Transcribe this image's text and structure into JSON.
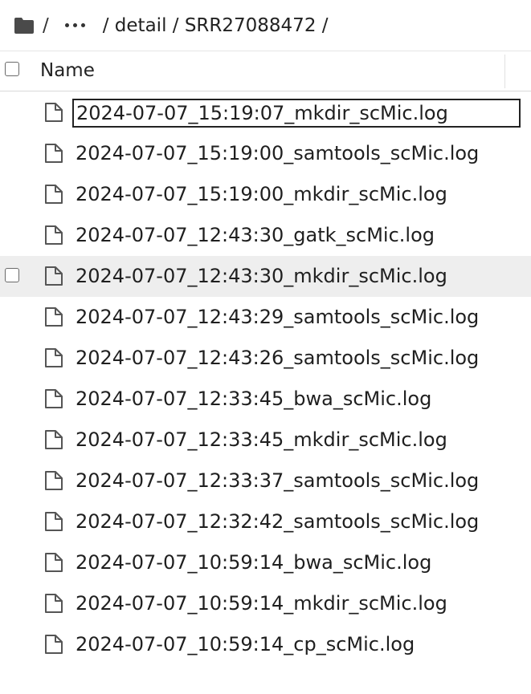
{
  "breadcrumb": {
    "root_sep": "/",
    "ellipsis_label": "…",
    "path_text": "/ detail / SRR27088472 /"
  },
  "table": {
    "header": {
      "name_label": "Name"
    },
    "rows": [
      {
        "name": "2024-07-07_15:19:07_mkdir_scMic.log",
        "state": "editing"
      },
      {
        "name": "2024-07-07_15:19:00_samtools_scMic.log",
        "state": "normal"
      },
      {
        "name": "2024-07-07_15:19:00_mkdir_scMic.log",
        "state": "normal"
      },
      {
        "name": "2024-07-07_12:43:30_gatk_scMic.log",
        "state": "normal"
      },
      {
        "name": "2024-07-07_12:43:30_mkdir_scMic.log",
        "state": "hover"
      },
      {
        "name": "2024-07-07_12:43:29_samtools_scMic.log",
        "state": "normal"
      },
      {
        "name": "2024-07-07_12:43:26_samtools_scMic.log",
        "state": "normal"
      },
      {
        "name": "2024-07-07_12:33:45_bwa_scMic.log",
        "state": "normal"
      },
      {
        "name": "2024-07-07_12:33:45_mkdir_scMic.log",
        "state": "normal"
      },
      {
        "name": "2024-07-07_12:33:37_samtools_scMic.log",
        "state": "normal"
      },
      {
        "name": "2024-07-07_12:32:42_samtools_scMic.log",
        "state": "normal"
      },
      {
        "name": "2024-07-07_10:59:14_bwa_scMic.log",
        "state": "normal"
      },
      {
        "name": "2024-07-07_10:59:14_mkdir_scMic.log",
        "state": "normal"
      },
      {
        "name": "2024-07-07_10:59:14_cp_scMic.log",
        "state": "normal"
      }
    ]
  },
  "icons": {
    "folder": "folder-icon",
    "file": "file-icon"
  },
  "colors": {
    "hover_row": "#eeeeee",
    "edit_border": "#222222"
  }
}
